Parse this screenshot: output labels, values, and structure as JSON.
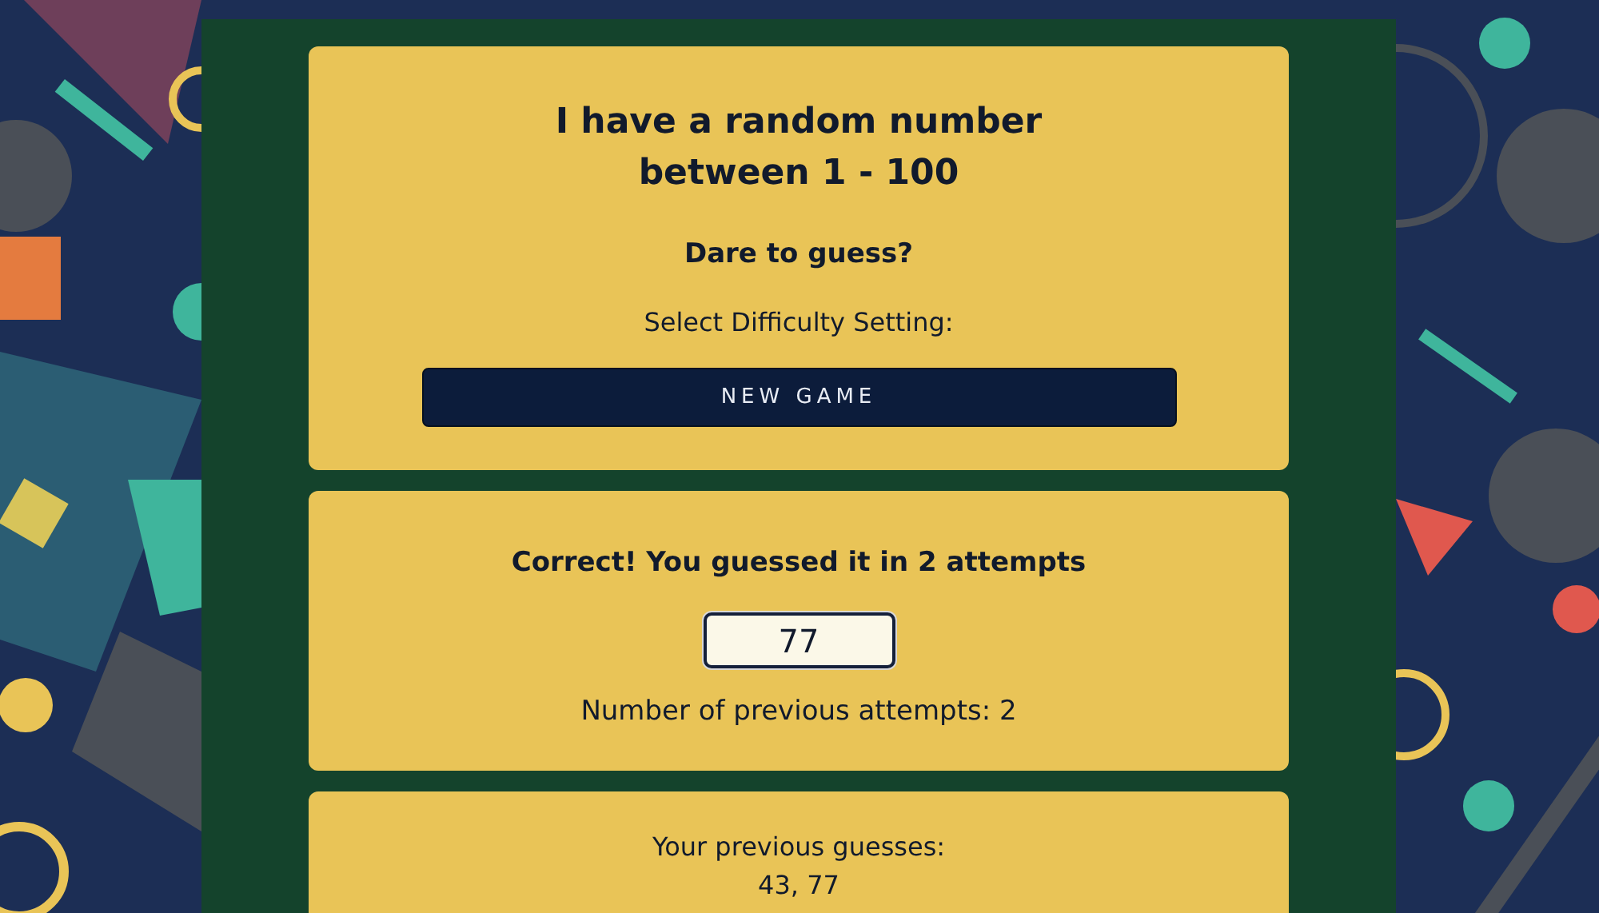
{
  "intro_card": {
    "heading": "I have a random number between 1 - 100",
    "subheading": "Dare to guess?",
    "difficulty_label": "Select Difficulty Setting:",
    "new_game_button": "NEW GAME"
  },
  "guess_card": {
    "result": "Correct! You guessed it in 2 attempts",
    "guess_input": {
      "value": "77"
    },
    "attempts": "Number of previous attempts: 2"
  },
  "history_card": {
    "title": "Your previous guesses:",
    "guesses": "43, 77"
  }
}
